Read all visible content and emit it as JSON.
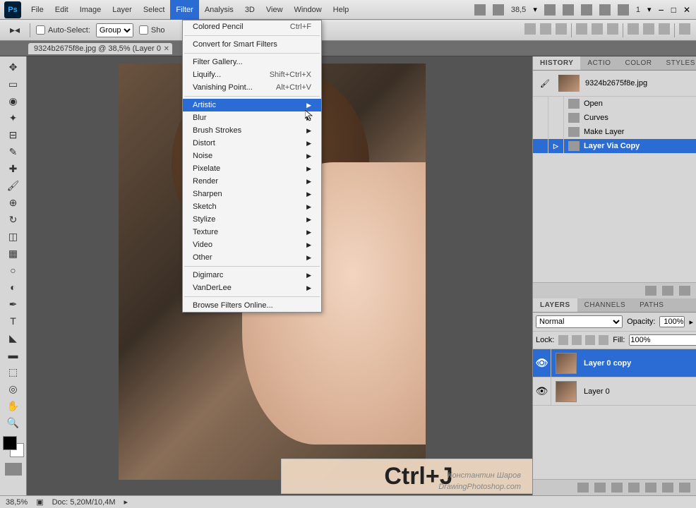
{
  "menubar": {
    "items": [
      "File",
      "Edit",
      "Image",
      "Layer",
      "Select",
      "Filter",
      "Analysis",
      "3D",
      "View",
      "Window",
      "Help"
    ],
    "active_index": 5,
    "zoom_display": "38,5",
    "workspace_num": "1"
  },
  "optionsbar": {
    "auto_select_label": "Auto-Select:",
    "auto_select_value": "Group",
    "show_label": "Sho"
  },
  "doctab": {
    "title": "9324b2675f8e.jpg @ 38,5% (Layer 0"
  },
  "dropdown": {
    "sections": [
      [
        {
          "label": "Colored Pencil",
          "shortcut": "Ctrl+F",
          "submenu": false
        }
      ],
      [
        {
          "label": "Convert for Smart Filters",
          "shortcut": "",
          "submenu": false
        }
      ],
      [
        {
          "label": "Filter Gallery...",
          "shortcut": "",
          "submenu": false
        },
        {
          "label": "Liquify...",
          "shortcut": "Shift+Ctrl+X",
          "submenu": false
        },
        {
          "label": "Vanishing Point...",
          "shortcut": "Alt+Ctrl+V",
          "submenu": false
        }
      ],
      [
        {
          "label": "Artistic",
          "shortcut": "",
          "submenu": true,
          "highlighted": true
        },
        {
          "label": "Blur",
          "shortcut": "",
          "submenu": true
        },
        {
          "label": "Brush Strokes",
          "shortcut": "",
          "submenu": true
        },
        {
          "label": "Distort",
          "shortcut": "",
          "submenu": true
        },
        {
          "label": "Noise",
          "shortcut": "",
          "submenu": true
        },
        {
          "label": "Pixelate",
          "shortcut": "",
          "submenu": true
        },
        {
          "label": "Render",
          "shortcut": "",
          "submenu": true
        },
        {
          "label": "Sharpen",
          "shortcut": "",
          "submenu": true
        },
        {
          "label": "Sketch",
          "shortcut": "",
          "submenu": true
        },
        {
          "label": "Stylize",
          "shortcut": "",
          "submenu": true
        },
        {
          "label": "Texture",
          "shortcut": "",
          "submenu": true
        },
        {
          "label": "Video",
          "shortcut": "",
          "submenu": true
        },
        {
          "label": "Other",
          "shortcut": "",
          "submenu": true
        }
      ],
      [
        {
          "label": "Digimarc",
          "shortcut": "",
          "submenu": true
        },
        {
          "label": "VanDerLee",
          "shortcut": "",
          "submenu": true
        }
      ],
      [
        {
          "label": "Browse Filters Online...",
          "shortcut": "",
          "submenu": false
        }
      ]
    ]
  },
  "history_panel": {
    "tabs": [
      "HISTORY",
      "ACTIO",
      "COLOR",
      "STYLES"
    ],
    "active_tab": 0,
    "snapshot": "9324b2675f8e.jpg",
    "items": [
      {
        "label": "Open",
        "selected": false
      },
      {
        "label": "Curves",
        "selected": false
      },
      {
        "label": "Make Layer",
        "selected": false
      },
      {
        "label": "Layer Via Copy",
        "selected": true
      }
    ]
  },
  "layers_panel": {
    "tabs": [
      "LAYERS",
      "CHANNELS",
      "PATHS"
    ],
    "active_tab": 0,
    "blend_mode": "Normal",
    "opacity_label": "Opacity:",
    "opacity_value": "100%",
    "lock_label": "Lock:",
    "fill_label": "Fill:",
    "fill_value": "100%",
    "layers": [
      {
        "name": "Layer 0 copy",
        "visible": true,
        "selected": true
      },
      {
        "name": "Layer 0",
        "visible": true,
        "selected": false
      }
    ]
  },
  "keystroke": "Ctrl+J",
  "watermark": {
    "line1": "Константин Шаров",
    "line2": "DrawingPhotoshop.com"
  },
  "statusbar": {
    "zoom": "38,5%",
    "doc_size": "Doc: 5,20M/10,4M"
  }
}
